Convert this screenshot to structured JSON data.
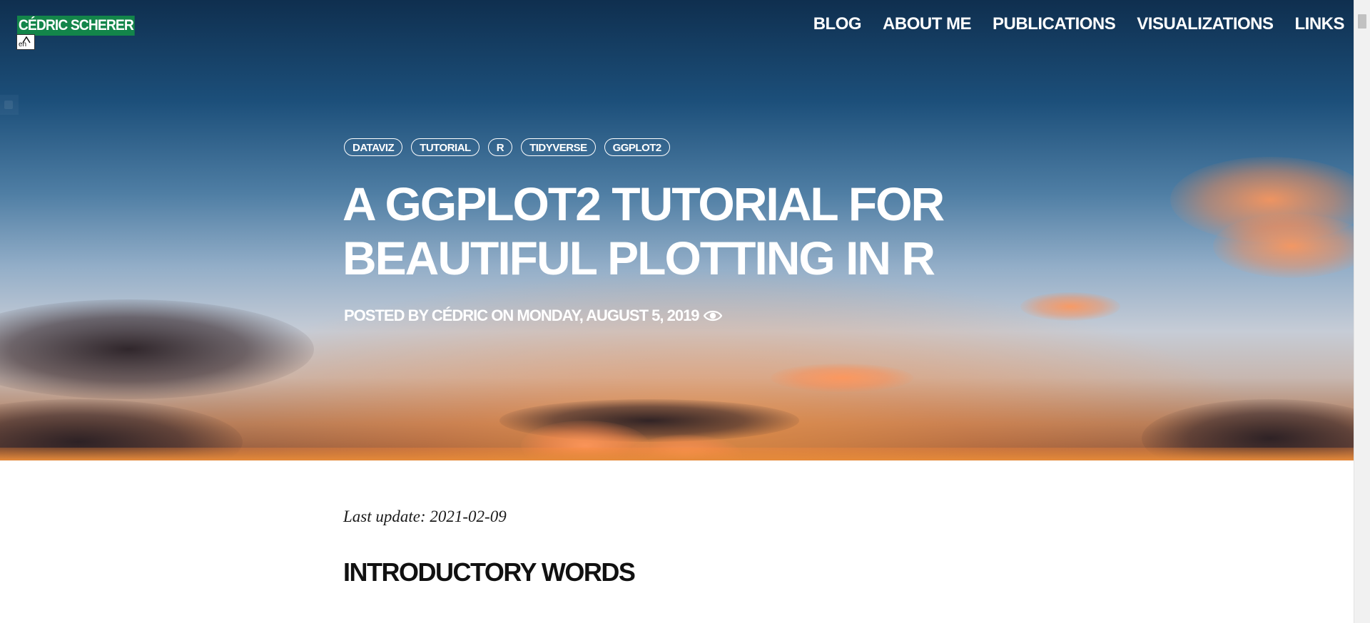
{
  "site": {
    "logo_text": "CÉDRIC SCHERER",
    "language_badge": "en"
  },
  "nav": {
    "items": [
      {
        "label": "BLOG"
      },
      {
        "label": "ABOUT ME"
      },
      {
        "label": "PUBLICATIONS"
      },
      {
        "label": "VISUALIZATIONS"
      },
      {
        "label": "LINKS"
      }
    ]
  },
  "post": {
    "tags": [
      "DATAVIZ",
      "TUTORIAL",
      "R",
      "TIDYVERSE",
      "GGPLOT2"
    ],
    "title": "A GGPLOT2 TUTORIAL FOR BEAUTIFUL PLOTTING IN R",
    "meta": "POSTED BY CÉDRIC ON MONDAY, AUGUST 5, 2019",
    "meta_icon": "eye-icon"
  },
  "content": {
    "last_update": "Last update: 2021-02-09",
    "section_heading": "INTRODUCTORY WORDS"
  },
  "colors": {
    "logo_background": "#13854a",
    "hero_text": "#ffffff"
  }
}
